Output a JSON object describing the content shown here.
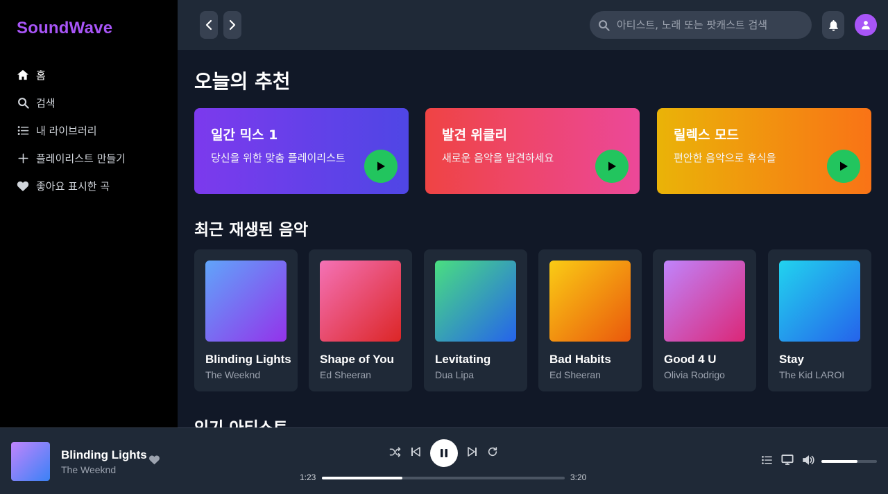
{
  "app": {
    "name": "SoundWave"
  },
  "sidebar": {
    "items": [
      {
        "label": "홈",
        "icon": "home-icon"
      },
      {
        "label": "검색",
        "icon": "search-icon"
      },
      {
        "label": "내 라이브러리",
        "icon": "list-icon"
      },
      {
        "label": "플레이리스트 만들기",
        "icon": "plus-icon"
      },
      {
        "label": "좋아요 표시한 곡",
        "icon": "heart-icon"
      }
    ]
  },
  "topbar": {
    "search_placeholder": "아티스트, 노래 또는 팟캐스트 검색"
  },
  "sections": {
    "recommend_title": "오늘의 추천",
    "recent_title": "최근 재생된 음악",
    "artists_title": "인기 아티스트"
  },
  "recommendations": [
    {
      "title": "일간 믹스 1",
      "subtitle": "당신을 위한 맞춤 플레이리스트",
      "colors": [
        "#7c3aed",
        "#4f46e5"
      ]
    },
    {
      "title": "발견 위클리",
      "subtitle": "새로운 음악을 발견하세요",
      "colors": [
        "#ef4444",
        "#ec4899"
      ]
    },
    {
      "title": "릴렉스 모드",
      "subtitle": "편안한 음악으로 휴식을",
      "colors": [
        "#eab308",
        "#f97316"
      ]
    }
  ],
  "recent": [
    {
      "title": "Blinding Lights",
      "artist": "The Weeknd",
      "colors": [
        "#60a5fa",
        "#9333ea"
      ]
    },
    {
      "title": "Shape of You",
      "artist": "Ed Sheeran",
      "colors": [
        "#f472b6",
        "#dc2626"
      ]
    },
    {
      "title": "Levitating",
      "artist": "Dua Lipa",
      "colors": [
        "#4ade80",
        "#2563eb"
      ]
    },
    {
      "title": "Bad Habits",
      "artist": "Ed Sheeran",
      "colors": [
        "#facc15",
        "#ea580c"
      ]
    },
    {
      "title": "Good 4 U",
      "artist": "Olivia Rodrigo",
      "colors": [
        "#c084fc",
        "#db2777"
      ]
    },
    {
      "title": "Stay",
      "artist": "The Kid LAROI",
      "colors": [
        "#22d3ee",
        "#2563eb"
      ]
    }
  ],
  "player": {
    "title": "Blinding Lights",
    "artist": "The Weeknd",
    "current_time": "1:23",
    "total_time": "3:20",
    "progress": 0.33,
    "volume": 0.65
  },
  "theme": {
    "accent": "#a855f7",
    "play_green": "#22c55e"
  }
}
